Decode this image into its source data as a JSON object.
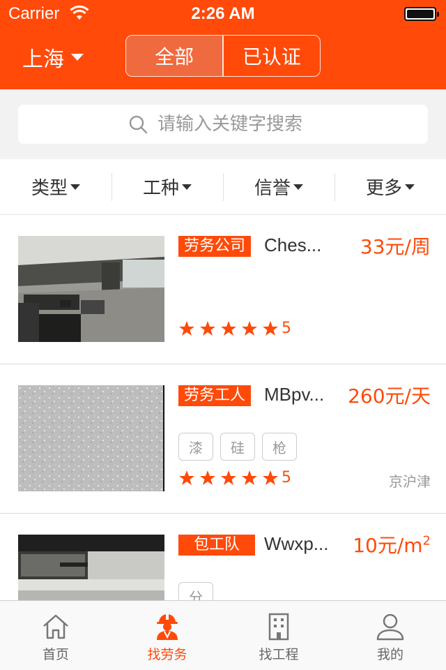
{
  "status_bar": {
    "carrier": "Carrier",
    "time": "2:26 AM"
  },
  "header": {
    "city": "上海",
    "segments": [
      "全部",
      "已认证"
    ],
    "active_segment": "全部"
  },
  "search": {
    "placeholder": "请输入关键字搜索"
  },
  "filters": [
    "类型",
    "工种",
    "信誉",
    "更多"
  ],
  "listings": [
    {
      "tag": "劳务公司",
      "name": "Ches...",
      "price": "33元/周",
      "skills": [],
      "rating": 5,
      "score": "5",
      "location": ""
    },
    {
      "tag": "劳务工人",
      "name": "MBpv...",
      "price": "260元/天",
      "skills": [
        "漆",
        "硅",
        "枪"
      ],
      "rating": 5,
      "score": "5",
      "location": "京沪津"
    },
    {
      "tag": "包工队",
      "name": "Wwxp...",
      "price_main": "10元/m",
      "price_sup": "2",
      "skills": [
        "分"
      ]
    }
  ],
  "tabbar": {
    "items": [
      "首页",
      "找劳务",
      "找工程",
      "我的"
    ],
    "active": "找劳务"
  },
  "colors": {
    "accent": "#ff4a0a",
    "segment_active": "#f06a3f",
    "muted": "#999999"
  }
}
